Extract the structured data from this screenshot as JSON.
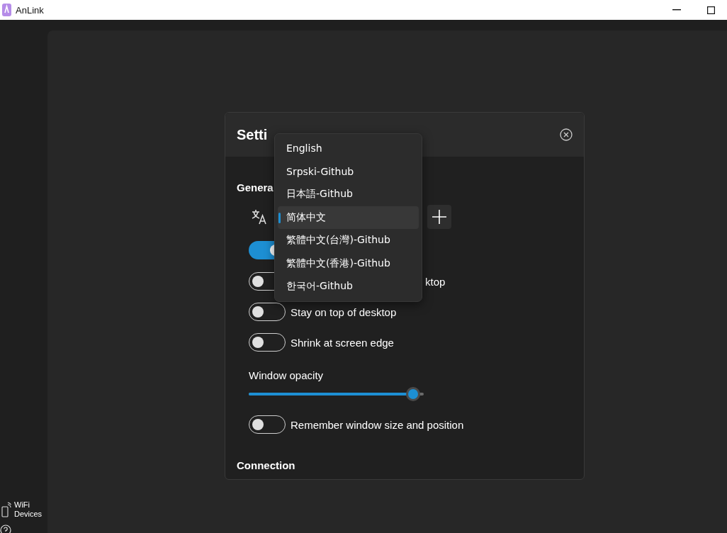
{
  "window": {
    "title": "AnLink"
  },
  "sidebar": {
    "items": [
      {
        "label": "WiFi Devices"
      }
    ]
  },
  "settings": {
    "title": "Setti",
    "general_heading": "Genera",
    "toggles": [
      {
        "on": true
      },
      {
        "label": "ktop",
        "on": false,
        "kind": "partly_covered"
      },
      {
        "label": "Stay on top of desktop",
        "on": false
      },
      {
        "label": "Shrink at screen edge",
        "on": false
      }
    ],
    "opacity": {
      "label": "Window opacity",
      "level": 0.94
    },
    "remember": {
      "label": "Remember window size and position",
      "on": false
    },
    "connection_heading": "Connection"
  },
  "language_menu": {
    "items": [
      {
        "label": "English",
        "selected": false
      },
      {
        "label": "Srpski-Github",
        "selected": false
      },
      {
        "label": "日本語-Github",
        "selected": false
      },
      {
        "label": "简体中文",
        "selected": true
      },
      {
        "label": "繁體中文(台灣)-Github",
        "selected": false
      },
      {
        "label": "繁體中文(香港)-Github",
        "selected": false
      },
      {
        "label": "한국어-Github",
        "selected": false
      }
    ]
  }
}
